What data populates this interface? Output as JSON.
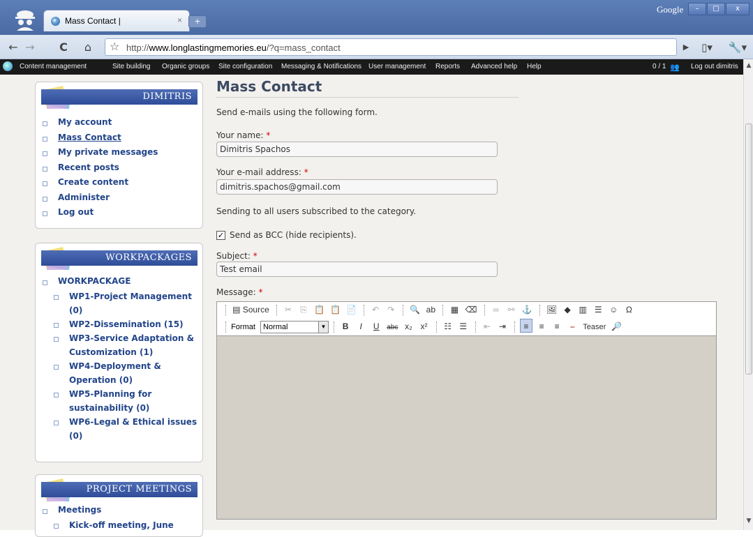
{
  "browser": {
    "tab_title": "Mass Contact |",
    "tab_close": "×",
    "new_tab": "+",
    "brand": "Google",
    "url_prefix": "http://",
    "url_host": "www.longlastingmemories.eu",
    "url_path": "/?q=mass_contact",
    "window_buttons": [
      "–",
      "□",
      "x"
    ]
  },
  "admin_menu": {
    "items": [
      "Content management",
      "Site building",
      "Organic groups",
      "Site configuration",
      "Messaging & Notifications",
      "User management",
      "Reports",
      "Advanced help",
      "Help"
    ],
    "users_online": "0 / 1",
    "logout": "Log out dimitris"
  },
  "sidebar": {
    "user_block": {
      "title": "DIMITRIS",
      "items": [
        "My account",
        "Mass Contact",
        "My private messages",
        "Recent posts",
        "Create content",
        "Administer",
        "Log out"
      ]
    },
    "workpackages_block": {
      "title": "WORKPACKAGES",
      "parent": "WORKPACKAGE",
      "items": [
        [
          "WP1-Project Management",
          "(0)"
        ],
        [
          "WP2-Dissemination (15)"
        ],
        [
          "WP3-Service Adaptation &",
          "Customization (1)"
        ],
        [
          "WP4-Deployment &",
          "Operation (0)"
        ],
        [
          "WP5-Planning for",
          "sustainability (0)"
        ],
        [
          "WP6-Legal & Ethical issues",
          "(0)"
        ]
      ]
    },
    "meetings_block": {
      "title": "PROJECT MEETINGS",
      "parent": "Meetings",
      "items": [
        "Kick-off meeting, June"
      ]
    }
  },
  "form": {
    "title": "Mass Contact",
    "intro": "Send e-mails using the following form.",
    "name_label": "Your name:",
    "name_value": "Dimitris Spachos",
    "email_label": "Your e-mail address:",
    "email_value": "dimitris.spachos@gmail.com",
    "category_text": "Sending to all users subscribed to the category.",
    "bcc_label": "Send as BCC (hide recipients).",
    "bcc_checked": "✓",
    "subject_label": "Subject:",
    "subject_value": "Test email",
    "message_label": "Message:",
    "required_mark": "*"
  },
  "editor": {
    "source_label": "Source",
    "format_label": "Format",
    "format_value": "Normal",
    "teaser_label": "Teaser"
  }
}
